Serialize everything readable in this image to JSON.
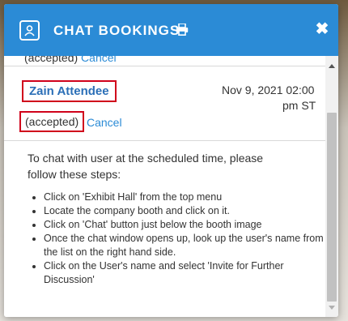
{
  "header": {
    "title": "CHAT BOOKINGS",
    "icons": {
      "contact": "contact-card-icon",
      "print": "print-icon",
      "close": "close-icon"
    },
    "close_label": "✖",
    "bg_color": "#2b8bd6"
  },
  "bookings": [
    {
      "status": "(accepted)",
      "cancel_label": "Cancel",
      "clipped": true
    },
    {
      "name": "Zain Attendee",
      "date_line1": "Nov 9, 2021 02:00",
      "date_line2": "pm ST",
      "status": "(accepted)",
      "cancel_label": "Cancel"
    }
  ],
  "instructions": {
    "intro": "To chat with user at the scheduled time, please follow these steps:",
    "steps": [
      "Click on 'Exhibit Hall' from the top menu",
      "Locate the company booth and click on it.",
      "Click on 'Chat' button just below the booth image",
      "Once the chat window opens up, look up the user's name from the list on the right hand side.",
      "Click on the User's name and select 'Invite for Further Discussion'"
    ]
  },
  "colors": {
    "link": "#2b8bd6",
    "highlight_border": "#d0021b"
  }
}
